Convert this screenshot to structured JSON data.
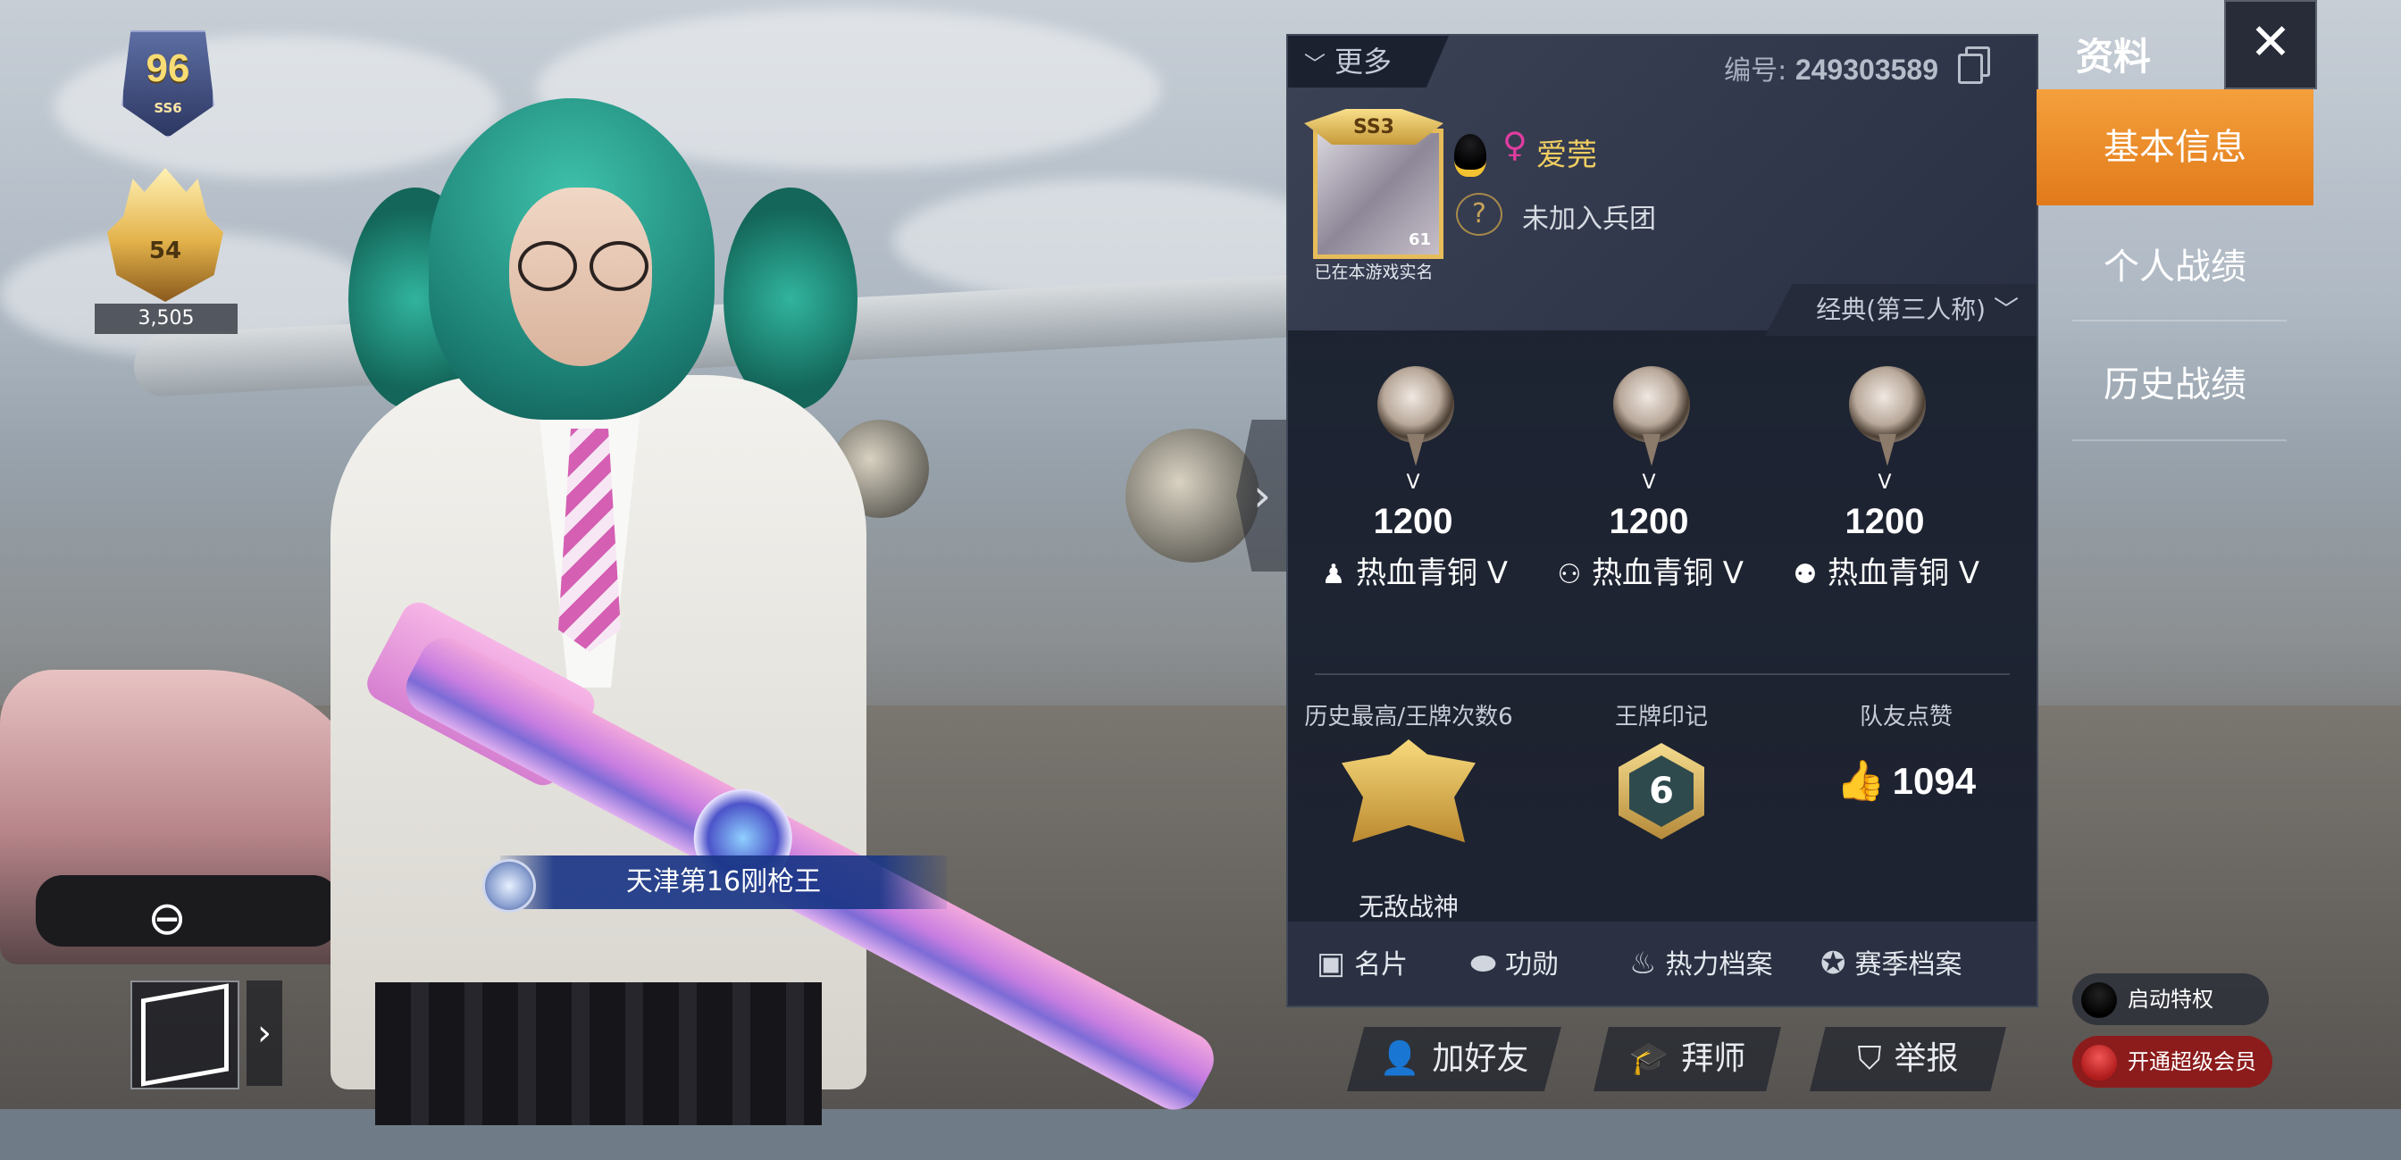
{
  "hud": {
    "rank_level": "96",
    "rank_tag": "SS6",
    "fire_level": "54",
    "fire_score": "3,505",
    "title_banner": "天津第16刚枪王"
  },
  "panel": {
    "more_tab": "更多",
    "id_label": "编号:",
    "id_value": "249303589",
    "avatar_tag": "SS3",
    "avatar_level": "61",
    "verified_text": "已在本游戏实名",
    "player_name": "爱莞",
    "legion_text": "未加入兵团",
    "mode_selector": "经典(第三人称)",
    "ranks": [
      {
        "tier": "V",
        "score": "1200",
        "label": "热血青铜 V",
        "mode_icon": "solo-icon"
      },
      {
        "tier": "V",
        "score": "1200",
        "label": "热血青铜 V",
        "mode_icon": "duo-icon"
      },
      {
        "tier": "V",
        "score": "1200",
        "label": "热血青铜 V",
        "mode_icon": "squad-icon"
      }
    ],
    "stats": {
      "best_label": "历史最高/王牌次数6",
      "best_title": "无敌战神",
      "ace_label": "王牌印记",
      "ace_value": "6",
      "likes_label": "队友点赞",
      "likes_value": "1094"
    },
    "bottom_bar": [
      {
        "label": "名片",
        "icon": "card-icon"
      },
      {
        "label": "功勋",
        "icon": "badge-icon"
      },
      {
        "label": "热力档案",
        "icon": "fire-icon"
      },
      {
        "label": "赛季档案",
        "icon": "season-icon"
      }
    ]
  },
  "sidebar": {
    "title": "资料",
    "items": [
      {
        "label": "基本信息",
        "active": true
      },
      {
        "label": "个人战绩",
        "active": false
      },
      {
        "label": "历史战绩",
        "active": false
      }
    ],
    "chip_privilege": "启动特权",
    "chip_vip": "开通超级会员"
  },
  "actions": {
    "add_friend": "加好友",
    "mentor": "拜师",
    "report": "举报"
  },
  "colors": {
    "accent_orange": "#e8871f",
    "name_gold": "#f0ce62",
    "gender_pink": "#e03ca0",
    "title_blue": "#1a3686"
  }
}
